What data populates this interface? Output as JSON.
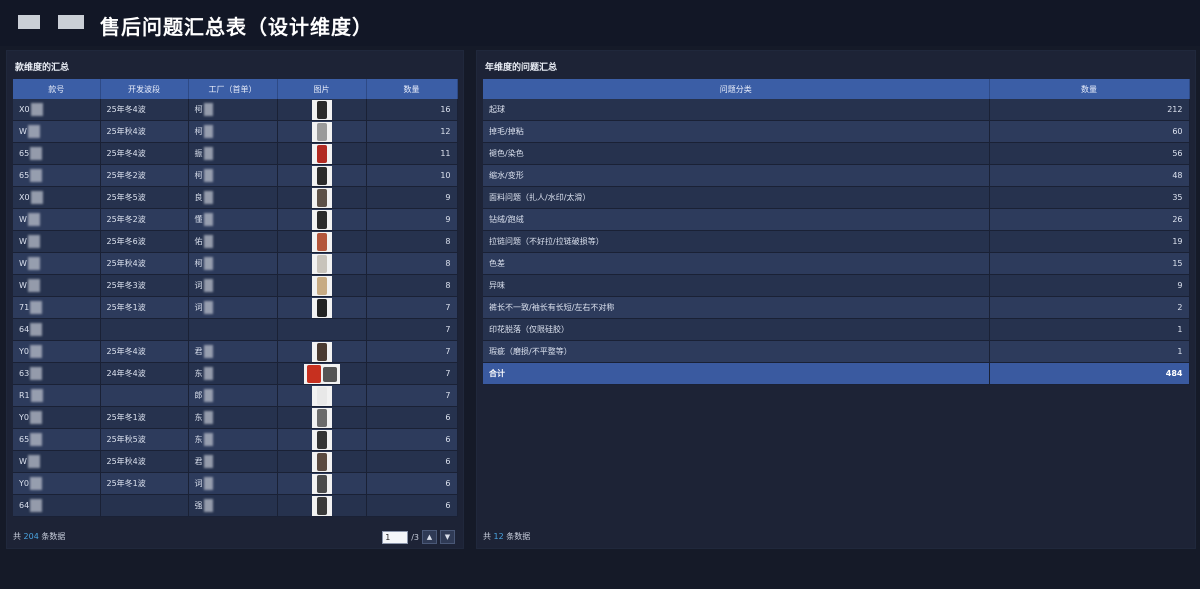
{
  "page": {
    "title": "售后问题汇总表（设计维度）"
  },
  "left_panel": {
    "title": "款维度的汇总",
    "columns": [
      "款号",
      "开发波段",
      "工厂（首单）",
      "图片",
      "数量"
    ],
    "rows": [
      {
        "code": "X0",
        "wave": "25年冬4波",
        "factory": "柯",
        "qty": "16",
        "img": "#2a2a2a"
      },
      {
        "code": "W",
        "wave": "25年秋4波",
        "factory": "柯",
        "qty": "12",
        "img": "#9a9a9a"
      },
      {
        "code": "65",
        "wave": "25年冬4波",
        "factory": "振",
        "qty": "11",
        "img": "#b12a22"
      },
      {
        "code": "65",
        "wave": "25年冬2波",
        "factory": "柯",
        "qty": "10",
        "img": "#2b2b2b"
      },
      {
        "code": "X0",
        "wave": "25年冬5波",
        "factory": "良",
        "qty": "9",
        "img": "#5d5148"
      },
      {
        "code": "W",
        "wave": "25年冬2波",
        "factory": "懂",
        "qty": "9",
        "img": "#2a2a2a"
      },
      {
        "code": "W",
        "wave": "25年冬6波",
        "factory": "佑",
        "qty": "8",
        "img": "#b3563b"
      },
      {
        "code": "W",
        "wave": "25年秋4波",
        "factory": "柯",
        "qty": "8",
        "img": "#c8c3bb"
      },
      {
        "code": "W",
        "wave": "25年冬3波",
        "factory": "词",
        "qty": "8",
        "img": "#c7ab84"
      },
      {
        "code": "71",
        "wave": "25年冬1波",
        "factory": "词",
        "qty": "7",
        "img": "#222222"
      },
      {
        "code": "64",
        "wave": "",
        "factory": "",
        "qty": "7",
        "img": ""
      },
      {
        "code": "Y0",
        "wave": "25年冬4波",
        "factory": "君",
        "qty": "7",
        "img": "#4a3a30"
      },
      {
        "code": "63",
        "wave": "24年冬4波",
        "factory": "东",
        "qty": "7",
        "img": "#c7301f",
        "img2": "#555555"
      },
      {
        "code": "R1",
        "wave": "",
        "factory": "郎",
        "qty": "7",
        "img": "#e8e8e8"
      },
      {
        "code": "Y0",
        "wave": "25年冬1波",
        "factory": "东",
        "qty": "6",
        "img": "#6b6b6b"
      },
      {
        "code": "65",
        "wave": "25年秋5波",
        "factory": "东",
        "qty": "6",
        "img": "#333333"
      },
      {
        "code": "W",
        "wave": "25年秋4波",
        "factory": "君",
        "qty": "6",
        "img": "#5a4a40"
      },
      {
        "code": "Y0",
        "wave": "25年冬1波",
        "factory": "词",
        "qty": "6",
        "img": "#4b4b4b"
      },
      {
        "code": "64",
        "wave": "",
        "factory": "强",
        "qty": "6",
        "img": "#3a3a3a"
      }
    ],
    "footer": {
      "prefix": "共",
      "count": "204",
      "suffix": "条数据"
    },
    "pager": {
      "page": "1",
      "total": "/3"
    }
  },
  "right_panel": {
    "title": "年维度的问题汇总",
    "columns": [
      "问题分类",
      "数量"
    ],
    "rows": [
      {
        "category": "起球",
        "qty": "212"
      },
      {
        "category": "掉毛/掉粘",
        "qty": "60"
      },
      {
        "category": "褪色/染色",
        "qty": "56"
      },
      {
        "category": "缩水/变形",
        "qty": "48"
      },
      {
        "category": "面料问题（扎人/水印/太滑）",
        "qty": "35"
      },
      {
        "category": "钻绒/跑绒",
        "qty": "26"
      },
      {
        "category": "拉链问题（不好拉/拉链破损等）",
        "qty": "19"
      },
      {
        "category": "色差",
        "qty": "15"
      },
      {
        "category": "异味",
        "qty": "9"
      },
      {
        "category": "裤长不一致/袖长有长短/左右不对称",
        "qty": "2"
      },
      {
        "category": "印花脱落（仅限硅胶）",
        "qty": "1"
      },
      {
        "category": "瑕疵（磨损/不平整等）",
        "qty": "1"
      }
    ],
    "total": {
      "label": "合计",
      "qty": "484"
    },
    "footer": {
      "prefix": "共",
      "count": "12",
      "suffix": "条数据"
    }
  }
}
